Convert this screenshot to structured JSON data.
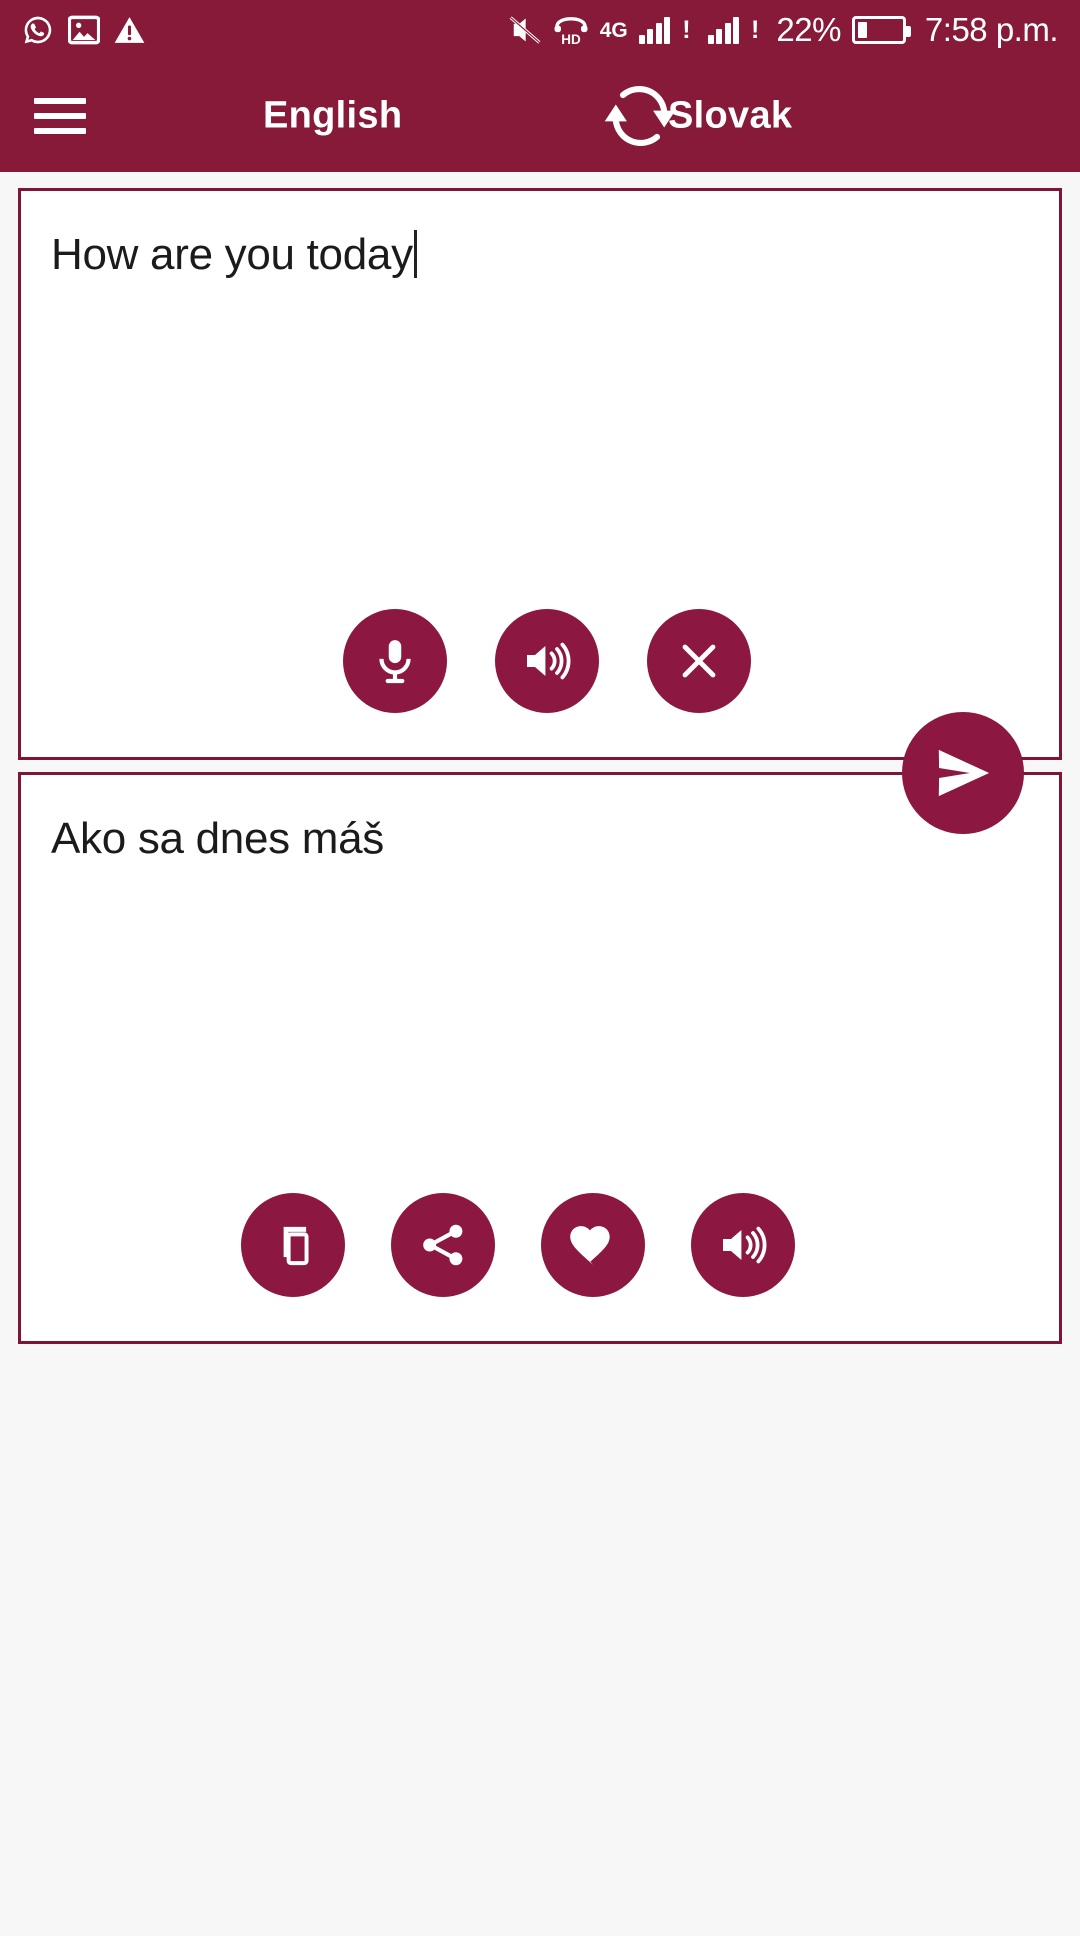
{
  "theme": {
    "primary": "#861A38",
    "accent": "#8C1740",
    "card_border": "#7E1536",
    "page_bg": "#f7f7f7",
    "on_primary": "#ffffff",
    "text": "#1b1b1b"
  },
  "status_bar": {
    "left_icons": [
      {
        "name": "whatsapp-icon",
        "label": "WhatsApp"
      },
      {
        "name": "image-icon",
        "label": "Screenshot saved"
      },
      {
        "name": "warning-icon",
        "label": "Warning"
      }
    ],
    "right_icons": [
      {
        "name": "mute-icon",
        "label": "Silent mode"
      },
      {
        "name": "hd-voice-icon",
        "label": "HD"
      },
      {
        "name": "network-type",
        "label": "4G"
      }
    ],
    "hd_label": "HD",
    "network_label": "4G",
    "signal_alert": "!",
    "battery_percent": "22%",
    "battery_level": 22,
    "time": "7:58 p.m."
  },
  "app_bar": {
    "menu_icon": "hamburger-menu-icon",
    "source_language": "English",
    "target_language": "Slovak",
    "swap_icon": "swap-languages-icon"
  },
  "source_card": {
    "text": "How are you today",
    "has_caret": true,
    "buttons": [
      {
        "name": "microphone-button",
        "icon": "microphone-icon",
        "label": "Speak"
      },
      {
        "name": "listen-source-button",
        "icon": "speaker-icon",
        "label": "Listen"
      },
      {
        "name": "clear-text-button",
        "icon": "close-icon",
        "label": "Clear"
      }
    ]
  },
  "send_button": {
    "name": "translate-send-button",
    "icon": "send-icon",
    "label": "Translate"
  },
  "target_card": {
    "text": "Ako sa dnes máš",
    "buttons": [
      {
        "name": "copy-button",
        "icon": "copy-icon",
        "label": "Copy"
      },
      {
        "name": "share-button",
        "icon": "share-icon",
        "label": "Share"
      },
      {
        "name": "favorite-button",
        "icon": "heart-icon",
        "label": "Favorite"
      },
      {
        "name": "listen-target-button",
        "icon": "speaker-icon",
        "label": "Listen"
      }
    ]
  }
}
